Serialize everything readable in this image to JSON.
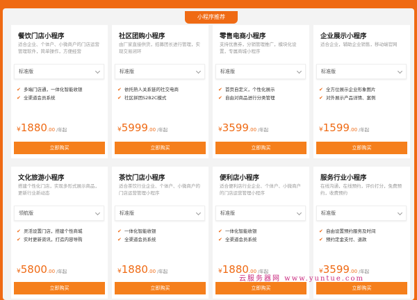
{
  "banner": "小程序推荐",
  "buy_label": "立即购买",
  "currency": "¥",
  "unit": "/年起",
  "decimals": ".00",
  "watermark": "云服务器网 www.yuntue.com",
  "cards": [
    {
      "title": "餐饮门店小程序",
      "desc": "适合企业、个体户、小微商户的门店运营管理软件，简单操作，方便经营",
      "edition": "标准版",
      "features": [
        "多端门店通，一体化智能收银",
        "全渠道会员系统"
      ],
      "price": "1880"
    },
    {
      "title": "社区团购小程序",
      "desc": "由厂家直接供货，招募团长进行管理，实现交易闭环",
      "edition": "标准版",
      "features": [
        "依托熟人关系链的社交电商",
        "社区拼团S2B2C模式"
      ],
      "price": "5999"
    },
    {
      "title": "零售电商小程序",
      "desc": "支持优惠券，分销管理推广，模块化设置，专属商城小程序",
      "edition": "标准版",
      "features": [
        "首页自定义，个性化展示",
        "自由对商品进行分类管理"
      ],
      "price": "3599"
    },
    {
      "title": "企业展示小程序",
      "desc": "适合企业，辅助企业销售，移动端官网",
      "edition": "标准版",
      "features": [
        "全方位展示企业形象图片",
        "对外展示产品详情、案例"
      ],
      "price": "1599"
    },
    {
      "title": "文化旅游小程序",
      "desc": "搭建个性化门店，实现多形式展示商品，更新行业新动态",
      "edition": "领航版",
      "features": [
        "灵活设置门店，搭建个性商城",
        "实时更新资讯，打造内容导购"
      ],
      "price": "5800"
    },
    {
      "title": "茶饮门店小程序",
      "desc": "适合茶饮行业企业、个体户、小微商户的门店运营管理小程序",
      "edition": "标准版",
      "features": [
        "一体化智能收银",
        "全渠道会员系统"
      ],
      "price": "1880"
    },
    {
      "title": "便利店小程序",
      "desc": "适合便利店行业企业、个体户、小微商户的门店运营管理小程序",
      "edition": "标准版",
      "features": [
        "一体化智能收银",
        "全渠道会员系统"
      ],
      "price": "1880"
    },
    {
      "title": "服务行业小程序",
      "desc": "在线沟通，在线预约，评价打分，免费预约，收费预约",
      "edition": "标准版",
      "features": [
        "自由设置预约服务及时间",
        "预约定金支付、退款"
      ],
      "price": "3599"
    }
  ]
}
